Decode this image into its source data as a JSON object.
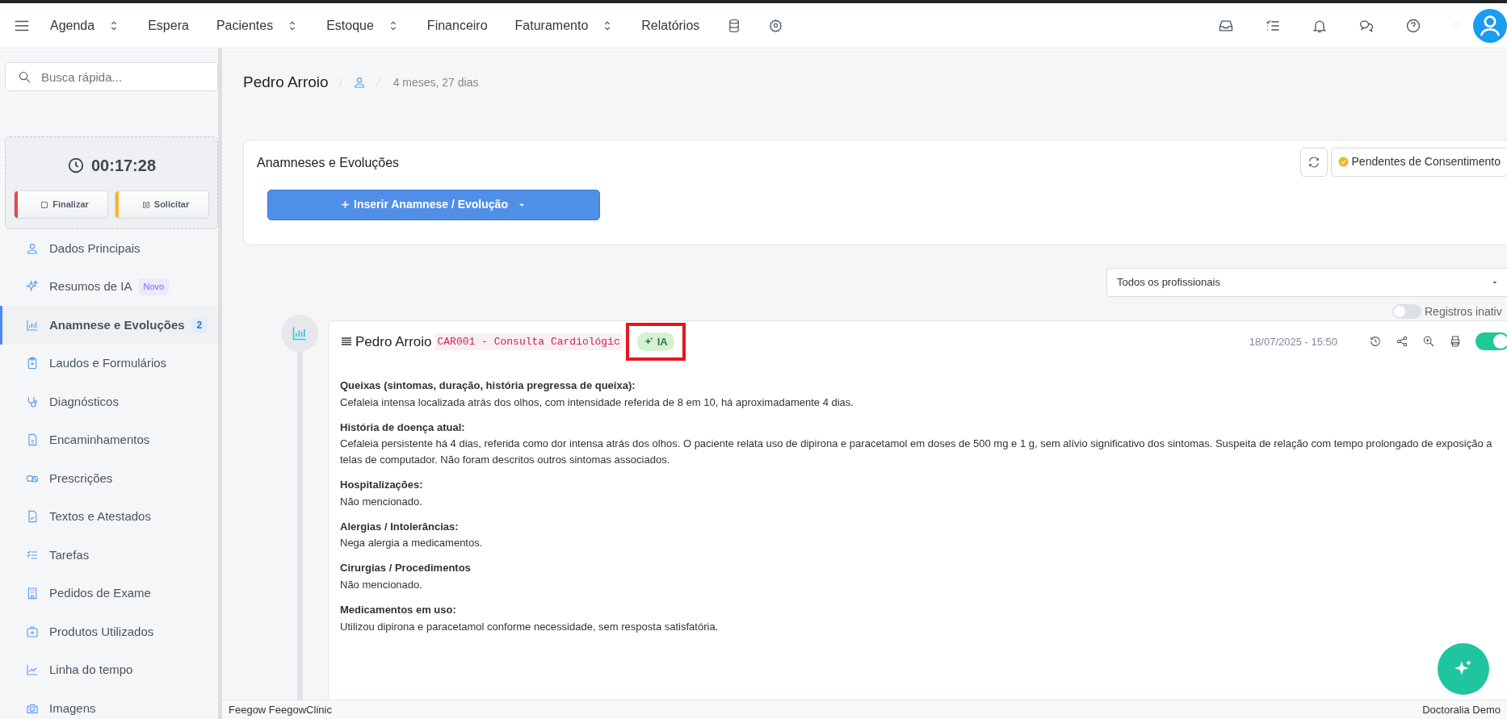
{
  "topnav": {
    "items": [
      {
        "label": "Agenda",
        "dropdown": true
      },
      {
        "label": "Espera",
        "dropdown": false
      },
      {
        "label": "Pacientes",
        "dropdown": true
      },
      {
        "label": "Estoque",
        "dropdown": true
      },
      {
        "label": "Financeiro",
        "dropdown": false
      },
      {
        "label": "Faturamento",
        "dropdown": true
      },
      {
        "label": "Relatórios",
        "dropdown": false
      }
    ]
  },
  "sidebar": {
    "search": {
      "placeholder": "Busca rápida..."
    },
    "timer": {
      "time": "00:17:28",
      "buttons": [
        {
          "label": "Finalizar",
          "color": "#e5484d"
        },
        {
          "label": "Solicitar",
          "color": "#f5b52e"
        }
      ]
    },
    "items": [
      {
        "label": "Dados Principais",
        "selected": false
      },
      {
        "label": "Resumos de IA",
        "selected": false,
        "tag": "Novo"
      },
      {
        "label": "Anamnese e Evoluções",
        "selected": true,
        "count": "2"
      },
      {
        "label": "Laudos e Formulários",
        "selected": false
      },
      {
        "label": "Diagnósticos",
        "selected": false
      },
      {
        "label": "Encaminhamentos",
        "selected": false
      },
      {
        "label": "Prescrições",
        "selected": false
      },
      {
        "label": "Textos e Atestados",
        "selected": false
      },
      {
        "label": "Tarefas",
        "selected": false
      },
      {
        "label": "Pedidos de Exame",
        "selected": false
      },
      {
        "label": "Produtos Utilizados",
        "selected": false
      },
      {
        "label": "Linha do tempo",
        "selected": false
      },
      {
        "label": "Imagens",
        "selected": false
      }
    ]
  },
  "patient": {
    "name": "Pedro Arroio",
    "age": "4 meses, 27 dias"
  },
  "panel": {
    "title": "Anamneses e Evoluções",
    "consent_button": "Pendentes de Consentimento",
    "insert_button": "Inserir Anamnese / Evolução"
  },
  "filter": {
    "professional": "Todos os profissionais",
    "inactive_toggle": {
      "label": "Registros inativ",
      "on": false
    }
  },
  "record": {
    "author": "Pedro Arroio",
    "code": "CAR001 - Consulta Cardiológic",
    "ia_badge": {
      "label": "IA",
      "highlighted": true
    },
    "datetime": "18/07/2025 - 15:50",
    "active": true,
    "sections": [
      {
        "heading": "Queixas (sintomas, duração, história pregressa de queixa):",
        "text": "Cefaleia intensa localizada atrás dos olhos, com intensidade referida de 8 em 10, há aproximadamente 4 dias."
      },
      {
        "heading": "História de doença atual:",
        "text": "Cefaleia persistente há 4 dias, referida como dor intensa atrás dos olhos. O paciente relata uso de dipirona e paracetamol em doses de 500 mg e 1 g, sem alívio significativo dos sintomas. Suspeita de relação com tempo prolongado de exposição a telas de computador. Não foram descritos outros sintomas associados."
      },
      {
        "heading": "Hospitalizações:",
        "text": "Não mencionado."
      },
      {
        "heading": "Alergias / Intolerâncias:",
        "text": "Nega alergia a medicamentos."
      },
      {
        "heading": "Cirurgias / Procedimentos",
        "text": "Não mencionado."
      },
      {
        "heading": "Medicamentos em uso:",
        "text": "Utilizou dipirona e paracetamol conforme necessidade, sem resposta satisfatória."
      }
    ]
  },
  "footer": {
    "left": "Feegow FeegowClinic",
    "right": "Doctoralia Demo"
  }
}
